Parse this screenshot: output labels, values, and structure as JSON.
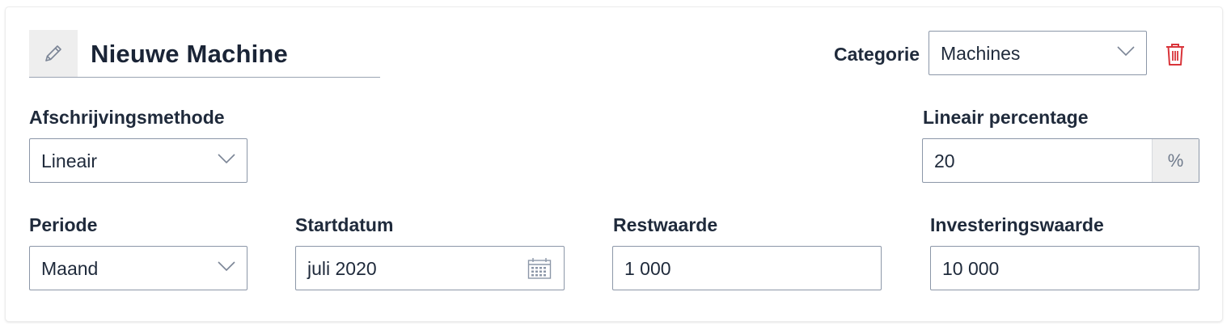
{
  "asset": {
    "name": "Nieuwe Machine",
    "edit_icon": "pencil-icon"
  },
  "category": {
    "label": "Categorie",
    "value": "Machines"
  },
  "delete_icon": "trash-icon",
  "depreciation_method": {
    "label": "Afschrijvingsmethode",
    "value": "Lineair"
  },
  "linear_percentage": {
    "label": "Lineair percentage",
    "value": "20",
    "suffix": "%"
  },
  "period": {
    "label": "Periode",
    "value": "Maand"
  },
  "start_date": {
    "label": "Startdatum",
    "value": "juli 2020",
    "icon": "calendar-icon"
  },
  "residual_value": {
    "label": "Restwaarde",
    "value": "1 000"
  },
  "investment_value": {
    "label": "Investeringswaarde",
    "value": "10 000"
  },
  "colors": {
    "delete": "#d9343a",
    "border": "#8c97a8",
    "text": "#1f2a3b"
  }
}
